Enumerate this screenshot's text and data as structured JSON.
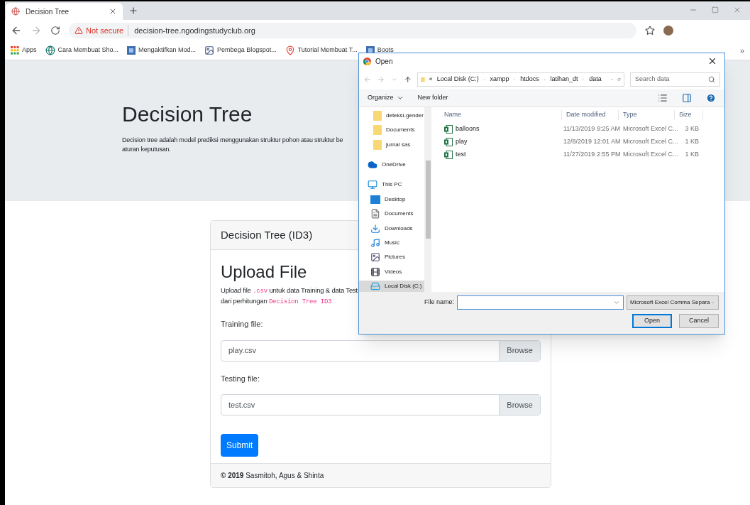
{
  "browser": {
    "tab": {
      "title": "Decision Tree",
      "selected": true
    },
    "security": "Not secure",
    "url": "decision-tree.ngodingstudyclub.org",
    "bookmarks": [
      {
        "label": "Apps",
        "kind": "apps"
      },
      {
        "label": "Cara Membuat Sho...",
        "kind": "globe"
      },
      {
        "label": "Mengaktifkan Mod...",
        "kind": "square"
      },
      {
        "label": "Pembega Blogspot...",
        "kind": "image"
      },
      {
        "label": "Tutorial Membuat T...",
        "kind": "pin"
      },
      {
        "label": "Boots",
        "kind": "square"
      }
    ],
    "more": "»"
  },
  "jumbotron": {
    "title": "Decision Tree",
    "lines": [
      "Decision tree adalah model prediksi menggunakan struktur pohon atau struktur be",
      "aturan keputusan."
    ]
  },
  "card": {
    "header": "Decision Tree (ID3)",
    "title": "Upload File",
    "description": [
      {
        "kind": "text",
        "text": "Upload file "
      },
      {
        "kind": "code",
        "text": ".csv"
      },
      {
        "kind": "text",
        "text": " untuk data Training & data Test"
      },
      {
        "kind": "break"
      },
      {
        "kind": "text",
        "text": "dari perhitungan "
      },
      {
        "kind": "code",
        "text": "Decision Tree ID3"
      }
    ],
    "fields": [
      {
        "label": "Training file:",
        "value": "play.csv",
        "button": "Browse"
      },
      {
        "label": "Testing file:",
        "value": "test.csv",
        "button": "Browse"
      }
    ],
    "submit": "Submit",
    "footer": {
      "year": "© 2019",
      "authors": "Sasmitoh, Agus & Shinta"
    }
  },
  "dialog": {
    "title": "Open",
    "path": [
      "«",
      "Local Disk (C:)",
      "xampp",
      "htdocs",
      "latihan_dt",
      "data"
    ],
    "search_placeholder": "Search data",
    "organize": "Organize",
    "new_folder": "New folder",
    "sidebar": [
      {
        "label": "deteksi-gender",
        "kind": "folder",
        "selected": false
      },
      {
        "label": "Documents",
        "kind": "folder",
        "selected": false
      },
      {
        "label": "jurnal sas",
        "kind": "folder",
        "selected": false
      },
      {
        "label": "OneDrive",
        "kind": "cloud",
        "selected": false
      },
      {
        "label": "This PC",
        "kind": "pc",
        "selected": false
      },
      {
        "label": "Desktop",
        "kind": "desktop",
        "selected": false
      },
      {
        "label": "Documents",
        "kind": "doc",
        "selected": false
      },
      {
        "label": "Downloads",
        "kind": "download",
        "selected": false
      },
      {
        "label": "Music",
        "kind": "music",
        "selected": false
      },
      {
        "label": "Pictures",
        "kind": "pictures",
        "selected": false
      },
      {
        "label": "Videos",
        "kind": "videos",
        "selected": false
      },
      {
        "label": "Local Disk (C:)",
        "kind": "disk",
        "selected": true
      }
    ],
    "columns": [
      "Name",
      "Date modified",
      "Type",
      "Size"
    ],
    "files": [
      {
        "name": "balloons",
        "date": "11/13/2019 9:25 AM",
        "type": "Microsoft Excel C...",
        "size": "3 KB"
      },
      {
        "name": "play",
        "date": "12/8/2019 12:01 AM",
        "type": "Microsoft Excel C...",
        "size": "1 KB"
      },
      {
        "name": "test",
        "date": "11/27/2019 2:55 PM",
        "type": "Microsoft Excel C...",
        "size": "1 KB"
      }
    ],
    "file_name_label": "File name:",
    "filter": "Microsoft Excel Comma Separa",
    "buttons": [
      {
        "label": "Open",
        "default": true
      },
      {
        "label": "Cancel",
        "default": false
      }
    ]
  }
}
